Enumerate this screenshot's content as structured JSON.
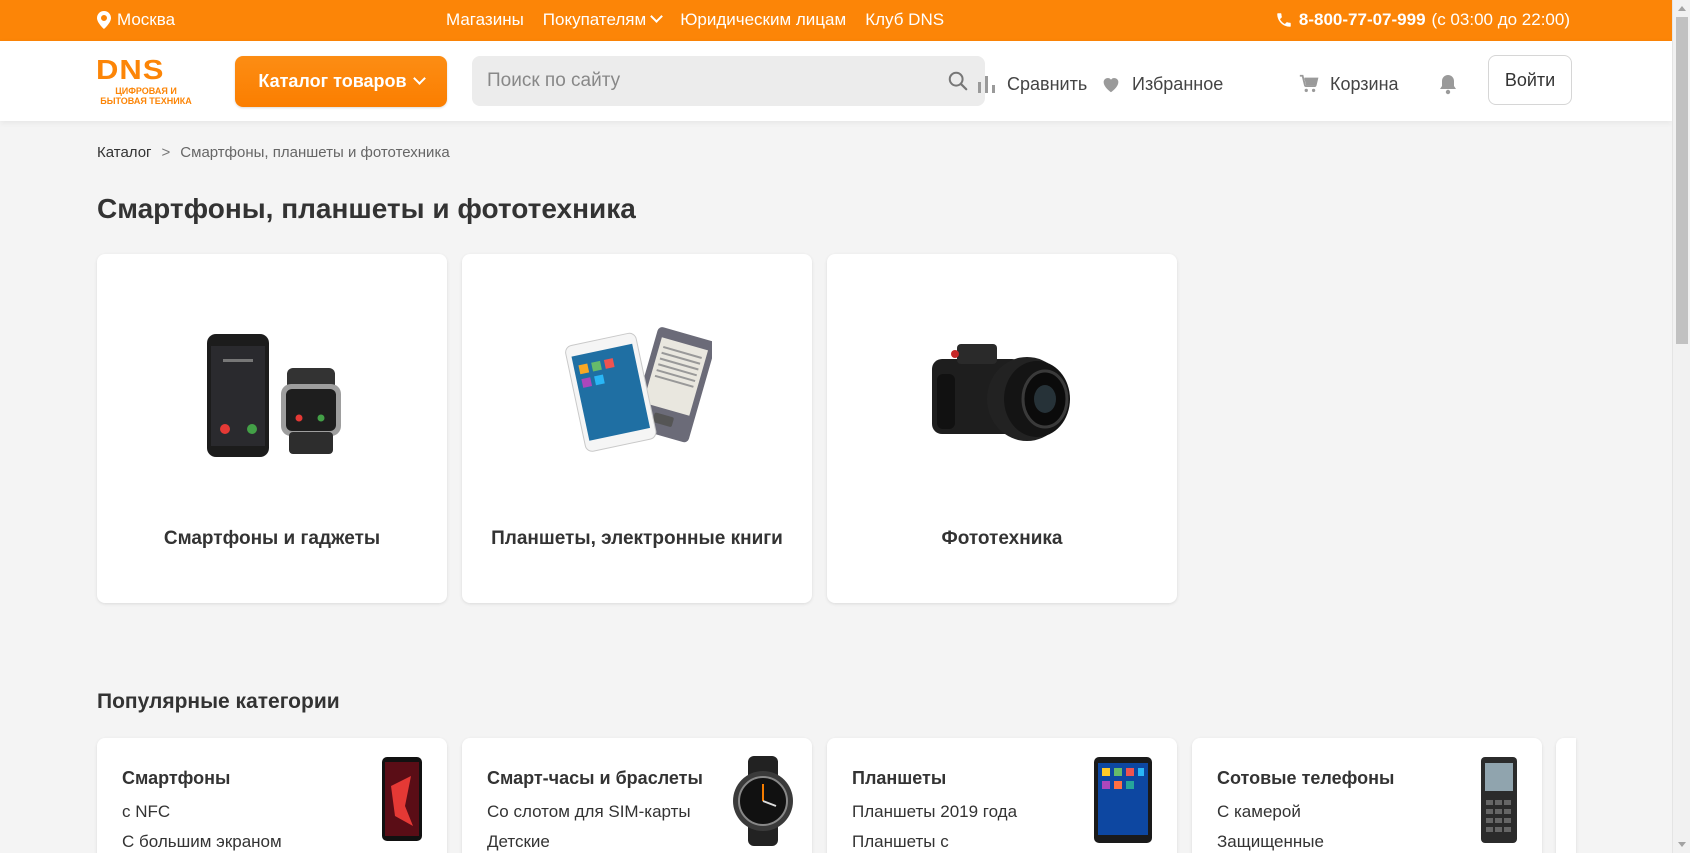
{
  "topbar": {
    "city": "Москва",
    "links": [
      "Магазины",
      "Покупателям",
      "Юридическим лицам",
      "Клуб DNS"
    ],
    "phone": "8-800-77-07-999",
    "hours": "(с 03:00 до 22:00)"
  },
  "header": {
    "logo_text": "DNS",
    "logo_sub_1": "ЦИФРОВАЯ И",
    "logo_sub_2": "БЫТОВАЯ ТЕХНИКА",
    "catalog_label": "Каталог товаров",
    "search_placeholder": "Поиск по сайту",
    "compare_label": "Сравнить",
    "favorites_label": "Избранное",
    "cart_label": "Корзина",
    "login_label": "Войти"
  },
  "breadcrumb": {
    "root": "Каталог",
    "separator": ">",
    "current": "Смартфоны, планшеты и фототехника"
  },
  "page_title": "Смартфоны, планшеты и фототехника",
  "categories": [
    {
      "label": "Смартфоны и гаджеты",
      "icon": "smartphone-watch-image"
    },
    {
      "label": "Планшеты, электронные книги",
      "icon": "tablet-ebook-image"
    },
    {
      "label": "Фототехника",
      "icon": "camera-image"
    }
  ],
  "popular": {
    "title": "Популярные категории",
    "cards": [
      {
        "title": "Смартфоны",
        "links": [
          "с NFC",
          "С большим экраном"
        ]
      },
      {
        "title": "Смарт-часы и браслеты",
        "links": [
          "Со слотом для SIM-карты",
          "Детские"
        ]
      },
      {
        "title": "Планшеты",
        "links": [
          "Планшеты 2019 года",
          "Планшеты с"
        ]
      },
      {
        "title": "Сотовые телефоны",
        "links": [
          "С камерой",
          "Защищенные"
        ]
      }
    ]
  },
  "colors": {
    "accent": "#fc8507",
    "background": "#f4f4f4"
  }
}
